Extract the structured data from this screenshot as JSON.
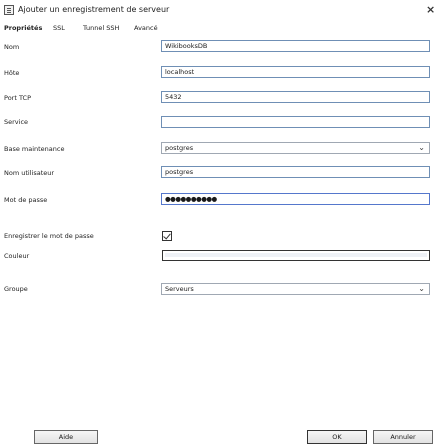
{
  "dialog": {
    "title": "Ajouter un enregistrement de serveur",
    "close_glyph": "×",
    "title_icon": "server-record-icon"
  },
  "tabs": [
    {
      "label": "Propriétés",
      "active": true
    },
    {
      "label": "SSL",
      "active": false
    },
    {
      "label": "Tunnel SSH",
      "active": false
    },
    {
      "label": "Avancé",
      "active": false
    }
  ],
  "form": {
    "name_label": "Nom",
    "name_value": "WikibooksDB",
    "host_label": "Hôte",
    "host_value": "localhost",
    "port_label": "Port TCP",
    "port_value": "5432",
    "service_label": "Service",
    "service_value": "",
    "maintenance_db_label": "Base maintenance",
    "maintenance_db_value": "postgres",
    "username_label": "Nom utilisateur",
    "username_value": "postgres",
    "password_label": "Mot de passe",
    "password_value": "●●●●●●●●●●",
    "store_password_label": "Enregistrer le mot de passe",
    "store_password_checked": true,
    "colour_label": "Couleur",
    "group_label": "Groupe",
    "group_value": "Serveurs"
  },
  "buttons": {
    "help": "Aide",
    "ok": "OK",
    "cancel": "Annuler"
  }
}
